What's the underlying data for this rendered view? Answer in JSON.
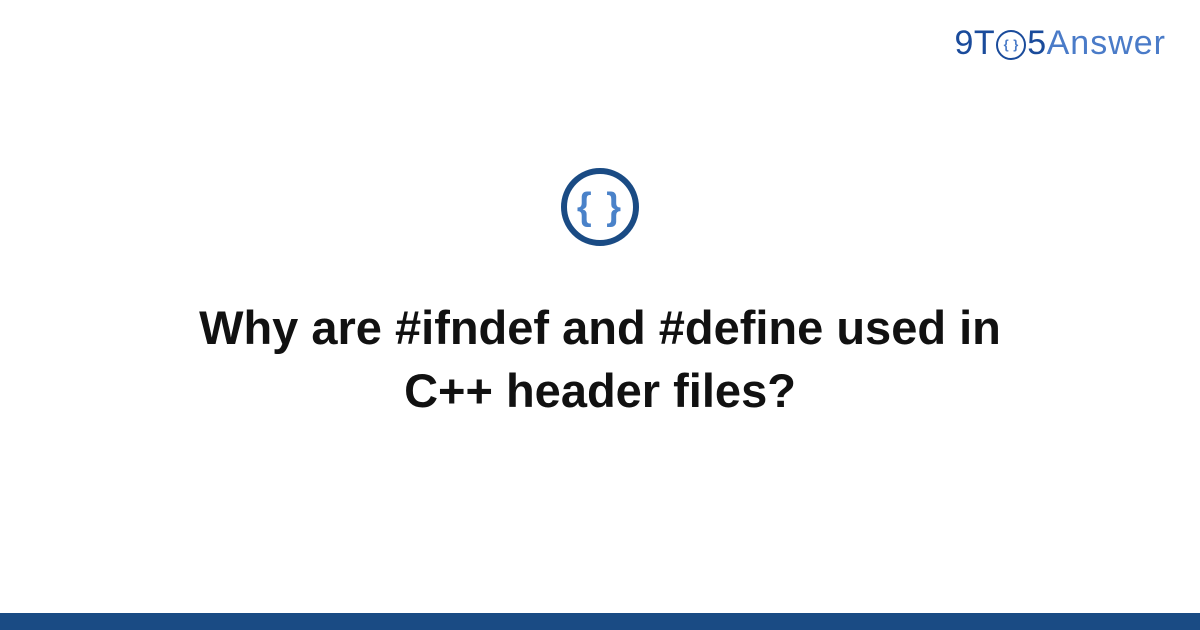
{
  "brand": {
    "nine": "9",
    "t": "T",
    "o_inner": "{ }",
    "five": "5",
    "answer": "Answer"
  },
  "logo": {
    "braces": "{ }"
  },
  "title": "Why are #ifndef and #define used in C++ header files?",
  "colors": {
    "primary_dark": "#1a4b84",
    "primary_blue": "#1a4b9b",
    "accent_blue": "#4a7bc8"
  }
}
